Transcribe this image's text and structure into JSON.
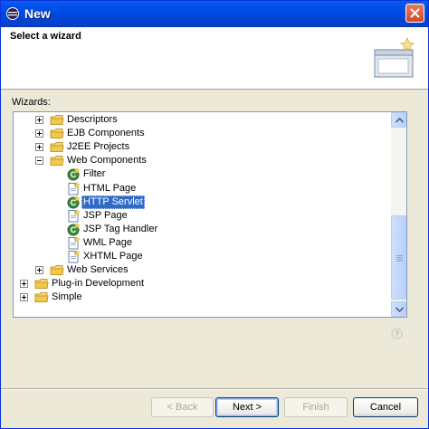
{
  "window": {
    "title": "New"
  },
  "banner": {
    "title": "Select a wizard"
  },
  "tree": {
    "label": "Wizards:",
    "items": [
      {
        "label": "Descriptors",
        "type": "folder",
        "expander": "+"
      },
      {
        "label": "EJB Components",
        "type": "folder",
        "expander": "+"
      },
      {
        "label": "J2EE Projects",
        "type": "folder",
        "expander": "+"
      },
      {
        "label": "Web Components",
        "type": "folder",
        "expander": "-"
      },
      {
        "label": "Filter",
        "type": "class"
      },
      {
        "label": "HTML Page",
        "type": "file"
      },
      {
        "label": "HTTP Servlet",
        "type": "class",
        "selected": true
      },
      {
        "label": "JSP Page",
        "type": "file"
      },
      {
        "label": "JSP Tag Handler",
        "type": "class"
      },
      {
        "label": "WML Page",
        "type": "file"
      },
      {
        "label": "XHTML Page",
        "type": "file"
      },
      {
        "label": "Web Services",
        "type": "folder",
        "expander": "+"
      },
      {
        "label": "Plug-in Development",
        "type": "folder",
        "expander": "+"
      },
      {
        "label": "Simple",
        "type": "folder",
        "expander": "+"
      }
    ]
  },
  "buttons": {
    "back": "< Back",
    "next": "Next >",
    "finish": "Finish",
    "cancel": "Cancel"
  },
  "colors": {
    "selection": "#316ac5",
    "titlebar": "#0050ee",
    "folder": "#f2c94c"
  }
}
